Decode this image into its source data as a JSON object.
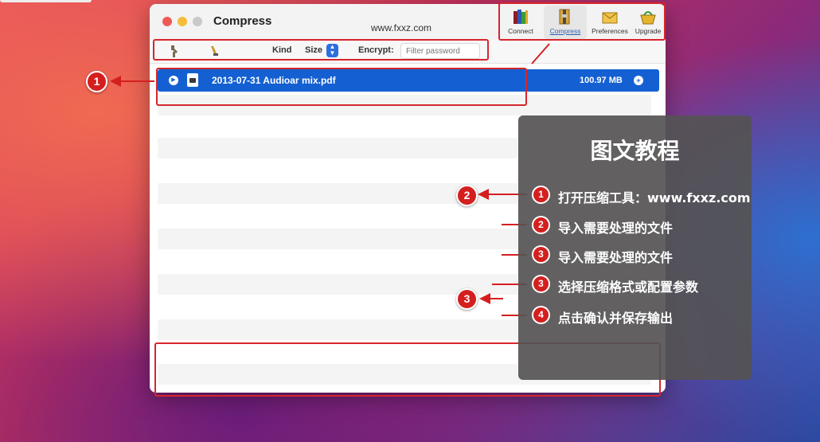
{
  "window": {
    "title": "Compress",
    "site": "www.fxxz.com"
  },
  "tools": [
    {
      "label": "Connect",
      "icon": "books-icon",
      "active": false
    },
    {
      "label": "Compress",
      "icon": "compress-icon",
      "active": true
    },
    {
      "label": "Preferences",
      "icon": "envelope-icon",
      "active": false
    },
    {
      "label": "Upgrade",
      "icon": "basket-icon",
      "active": false
    }
  ],
  "toolbar": {
    "kind_label": "Kind",
    "size_label": "Size",
    "encrypt_label": "Encrypt:",
    "password_placeholder": "Filter password"
  },
  "file": {
    "name": "2013-07-31 Audioar mix.pdf",
    "size": "100.97 MB"
  },
  "callouts": {
    "c1": "1",
    "c2": "2",
    "c3": "3"
  },
  "panel": {
    "title": "图文教程",
    "steps": [
      {
        "num": "1",
        "text": "打开压缩工具：www.fxxz.com"
      },
      {
        "num": "2",
        "text": "导入需要处理的文件"
      },
      {
        "num": "3",
        "text": "导入需要处理的文件"
      },
      {
        "num": "3",
        "text": "选择压缩格式或配置参数"
      },
      {
        "num": "4",
        "text": "点击确认并保存输出"
      }
    ]
  },
  "colors": {
    "accent_blue": "#1460d2",
    "callout_red": "#d41f1f"
  }
}
